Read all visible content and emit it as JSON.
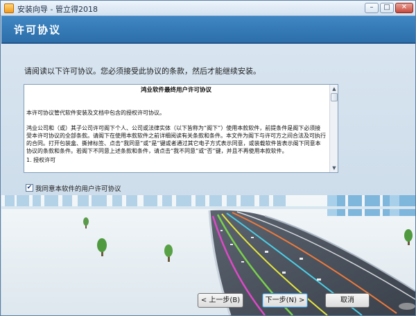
{
  "window": {
    "title": "安装向导 - 管立得2018"
  },
  "header": {
    "title": "许可协议"
  },
  "instruction": "请阅读以下许可协议。您必须接受此协议的条款，然后才能继续安装。",
  "license": {
    "title": "鸿业软件最终用户许可协议",
    "paragraph1": "本许可协议管代软件安装及文档中包含的授权许可协议。",
    "paragraph2": "鸿业公司和（或）其子公司许可阁下个人、公司或法律实体（以下皆称为“阁下”）使用本款软件，前提条件是阁下必须接受本许可协议的全部条款。请阁下在使用本款软件之前详细阅读有关条款和条件。本文件为阁下与许可方之间合法及可执行的合同。打开包装盒、撕掉标签、点击“我同意”或“是”键或者通过其它电子方式表示同意，或装载软件皆表示阁下同意本协议的条款和条件。若阁下不同意上述条款和条件，请点击“我不同意”或“否”键，并且不再使用本款软件。",
    "paragraph3": "1. 授权许可"
  },
  "agree": {
    "label": "我同意本软件的用户许可协议",
    "checked": true,
    "check_glyph": "✔"
  },
  "buttons": {
    "prev": "< 上一步(B)",
    "next": "下一步(N) >",
    "cancel": "取消"
  },
  "window_buttons": {
    "minimize": "–",
    "maximize": "□",
    "close": "✕"
  },
  "colors": {
    "header": "#2f74b0",
    "sky": "#cfe2f1"
  }
}
